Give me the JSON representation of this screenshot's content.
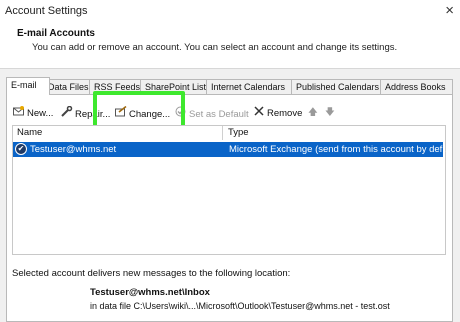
{
  "window": {
    "title": "Account Settings",
    "close_glyph": "×"
  },
  "header": {
    "title": "E-mail Accounts",
    "subtitle": "You can add or remove an account. You can select an account and change its settings."
  },
  "tabs": [
    {
      "label": "E-mail",
      "active": true
    },
    {
      "label": "Data Files"
    },
    {
      "label": "RSS Feeds"
    },
    {
      "label": "SharePoint Lists"
    },
    {
      "label": "Internet Calendars"
    },
    {
      "label": "Published Calendars"
    },
    {
      "label": "Address Books"
    }
  ],
  "toolbar": {
    "new_label": "New...",
    "repair_label": "Repair...",
    "change_label": "Change...",
    "set_default_label": "Set as Default",
    "remove_label": "Remove",
    "up_arrow": "🡅",
    "down_arrow": "🡇",
    "icons": {
      "new": "new-email-icon",
      "repair": "repair-icon",
      "change": "change-icon",
      "set_default": "set-default-icon",
      "remove": "remove-x-icon"
    }
  },
  "accounts_table": {
    "columns": [
      "Name",
      "Type"
    ],
    "rows": [
      {
        "name": "Testuser@whms.net",
        "type": "Microsoft Exchange (send from this account by def...",
        "selected": true,
        "default": true
      }
    ]
  },
  "delivery": {
    "label": "Selected account delivers new messages to the following location:",
    "folder": "Testuser@whms.net\\Inbox",
    "data_file": "in data file C:\\Users\\wiki\\...\\Microsoft\\Outlook\\Testuser@whms.net - test.ost"
  },
  "colors": {
    "selection": "#0a64c8",
    "highlight": "#3ee82e"
  }
}
